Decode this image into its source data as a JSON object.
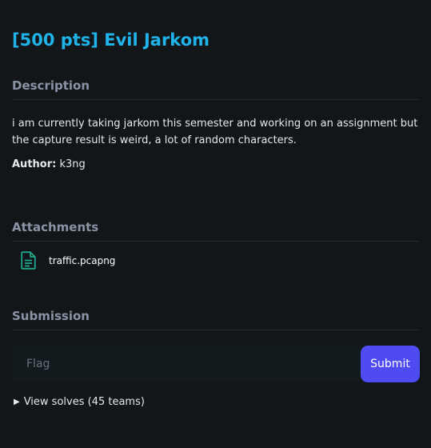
{
  "challenge": {
    "title": "[500 pts] Evil Jarkom"
  },
  "description": {
    "heading": "Description",
    "text": "i am currently taking jarkom this semester and working on an assignment but the capture result is weird, a lot of random characters.",
    "author_label": "Author:",
    "author_value": "k3ng"
  },
  "attachments": {
    "heading": "Attachments",
    "items": [
      {
        "name": "traffic.pcapng",
        "icon": "file-document-icon",
        "icon_color": "#1ea58a"
      }
    ]
  },
  "submission": {
    "heading": "Submission",
    "flag_placeholder": "Flag",
    "flag_value": "",
    "submit_label": "Submit",
    "solves_toggle_icon": "▶",
    "solves_label": "View solves (45 teams)"
  },
  "colors": {
    "background": "#121619",
    "title": "#1fb3ea",
    "heading": "#8b93a6",
    "submit_button": "#4e4bf2",
    "attachment_icon": "#1ea58a"
  }
}
